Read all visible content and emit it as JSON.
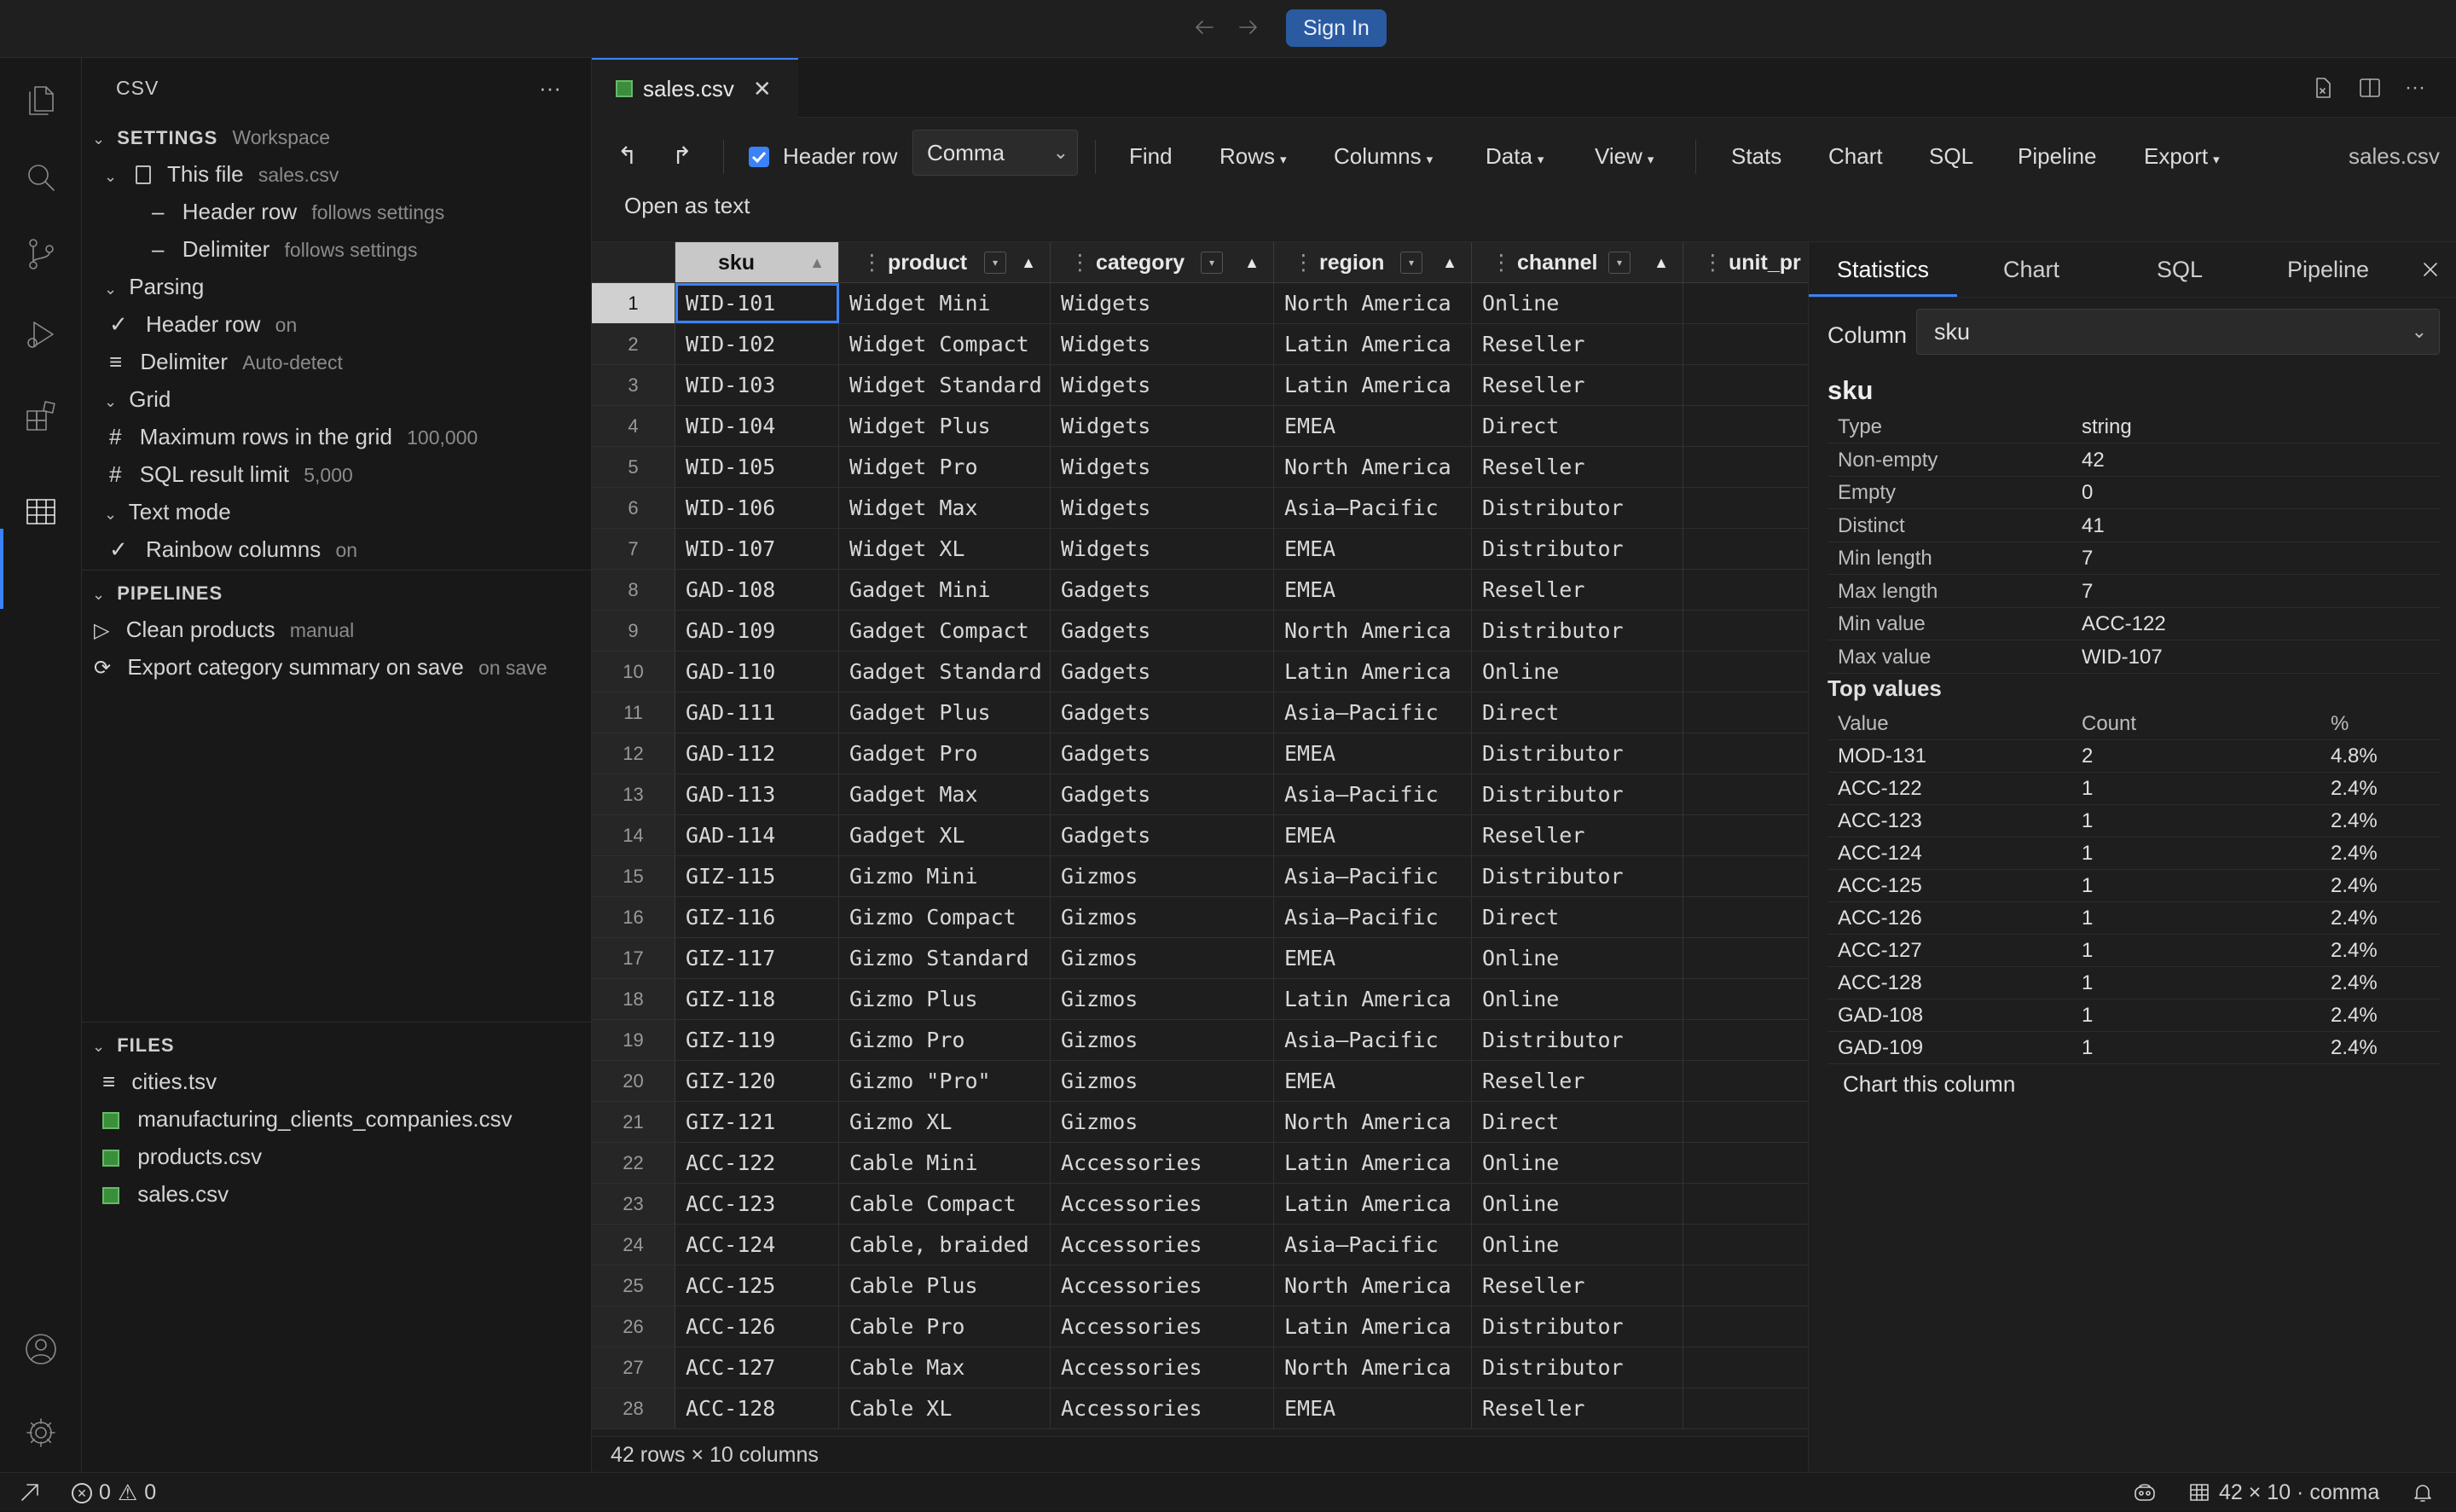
{
  "titlebar": {
    "sign_in": "Sign In"
  },
  "sidebar": {
    "title": "CSV",
    "more": "···",
    "settings_title": "SETTINGS",
    "settings_scope": "Workspace",
    "this_file_label": "This file",
    "this_file_name": "sales.csv",
    "header_row_label": "Header row",
    "header_row_note": "follows settings",
    "delimiter_label": "Delimiter",
    "delimiter_note": "follows settings",
    "parsing_label": "Parsing",
    "parsing_header_label": "Header row",
    "parsing_header_value": "on",
    "parsing_delim_label": "Delimiter",
    "parsing_delim_value": "Auto-detect",
    "grid_label": "Grid",
    "max_rows_label": "Maximum rows in the grid",
    "max_rows_value": "100,000",
    "sql_limit_label": "SQL result limit",
    "sql_limit_value": "5,000",
    "text_mode_label": "Text mode",
    "rainbow_label": "Rainbow columns",
    "rainbow_value": "on",
    "pipelines_title": "PIPELINES",
    "pipeline_1": "Clean products",
    "pipeline_1_mode": "manual",
    "pipeline_2": "Export category summary on save",
    "pipeline_2_mode": "on save",
    "files_title": "FILES",
    "files": [
      "cities.tsv",
      "manufacturing_clients_companies.csv",
      "products.csv",
      "sales.csv"
    ]
  },
  "tab": {
    "name": "sales.csv"
  },
  "toolbar": {
    "header_row": "Header row",
    "delimiter": "Comma",
    "find": "Find",
    "rows": "Rows",
    "columns": "Columns",
    "data": "Data",
    "view": "View",
    "stats": "Stats",
    "chart": "Chart",
    "sql": "SQL",
    "pipeline": "Pipeline",
    "export": "Export",
    "file": "sales.csv",
    "open_as_text": "Open as text"
  },
  "grid": {
    "columns": [
      "sku",
      "product",
      "category",
      "region",
      "channel",
      "unit_pr"
    ],
    "rows": [
      [
        "1",
        "WID-101",
        "Widget Mini",
        "Widgets",
        "North America",
        "Online"
      ],
      [
        "2",
        "WID-102",
        "Widget Compact",
        "Widgets",
        "Latin America",
        "Reseller"
      ],
      [
        "3",
        "WID-103",
        "Widget Standard",
        "Widgets",
        "Latin America",
        "Reseller"
      ],
      [
        "4",
        "WID-104",
        "Widget Plus",
        "Widgets",
        "EMEA",
        "Direct"
      ],
      [
        "5",
        "WID-105",
        "Widget Pro",
        "Widgets",
        "North America",
        "Reseller"
      ],
      [
        "6",
        "WID-106",
        "Widget Max",
        "Widgets",
        "Asia–Pacific",
        "Distributor"
      ],
      [
        "7",
        "WID-107",
        "Widget XL",
        "Widgets",
        "EMEA",
        "Distributor"
      ],
      [
        "8",
        "GAD-108",
        "Gadget Mini",
        "Gadgets",
        "EMEA",
        "Reseller"
      ],
      [
        "9",
        "GAD-109",
        "Gadget Compact",
        "Gadgets",
        "North America",
        "Distributor"
      ],
      [
        "10",
        "GAD-110",
        "Gadget Standard",
        "Gadgets",
        "Latin America",
        "Online"
      ],
      [
        "11",
        "GAD-111",
        "Gadget Plus",
        "Gadgets",
        "Asia–Pacific",
        "Direct"
      ],
      [
        "12",
        "GAD-112",
        "Gadget Pro",
        "Gadgets",
        "EMEA",
        "Distributor"
      ],
      [
        "13",
        "GAD-113",
        "Gadget Max",
        "Gadgets",
        "Asia–Pacific",
        "Distributor"
      ],
      [
        "14",
        "GAD-114",
        "Gadget XL",
        "Gadgets",
        "EMEA",
        "Reseller"
      ],
      [
        "15",
        "GIZ-115",
        "Gizmo Mini",
        "Gizmos",
        "Asia–Pacific",
        "Distributor"
      ],
      [
        "16",
        "GIZ-116",
        "Gizmo Compact",
        "Gizmos",
        "Asia–Pacific",
        "Direct"
      ],
      [
        "17",
        "GIZ-117",
        "Gizmo Standard",
        "Gizmos",
        "EMEA",
        "Online"
      ],
      [
        "18",
        "GIZ-118",
        "Gizmo Plus",
        "Gizmos",
        "Latin America",
        "Online"
      ],
      [
        "19",
        "GIZ-119",
        "Gizmo Pro",
        "Gizmos",
        "Asia–Pacific",
        "Distributor"
      ],
      [
        "20",
        "GIZ-120",
        "Gizmo \"Pro\"",
        "Gizmos",
        "EMEA",
        "Reseller"
      ],
      [
        "21",
        "GIZ-121",
        "Gizmo XL",
        "Gizmos",
        "North America",
        "Direct"
      ],
      [
        "22",
        "ACC-122",
        "Cable Mini",
        "Accessories",
        "Latin America",
        "Online"
      ],
      [
        "23",
        "ACC-123",
        "Cable Compact",
        "Accessories",
        "Latin America",
        "Online"
      ],
      [
        "24",
        "ACC-124",
        "Cable, braided",
        "Accessories",
        "Asia–Pacific",
        "Online"
      ],
      [
        "25",
        "ACC-125",
        "Cable Plus",
        "Accessories",
        "North America",
        "Reseller"
      ],
      [
        "26",
        "ACC-126",
        "Cable Pro",
        "Accessories",
        "Latin America",
        "Distributor"
      ],
      [
        "27",
        "ACC-127",
        "Cable Max",
        "Accessories",
        "North America",
        "Distributor"
      ],
      [
        "28",
        "ACC-128",
        "Cable XL",
        "Accessories",
        "EMEA",
        "Reseller"
      ]
    ],
    "summary": "42 rows × 10 columns"
  },
  "panel": {
    "tabs": [
      "Statistics",
      "Chart",
      "SQL",
      "Pipeline"
    ],
    "column_label": "Column",
    "column_value": "sku",
    "column_name": "sku",
    "stats": [
      [
        "Type",
        "string"
      ],
      [
        "Non-empty",
        "42"
      ],
      [
        "Empty",
        "0"
      ],
      [
        "Distinct",
        "41"
      ],
      [
        "Min length",
        "7"
      ],
      [
        "Max length",
        "7"
      ],
      [
        "Min value",
        "ACC-122"
      ],
      [
        "Max value",
        "WID-107"
      ]
    ],
    "top_values_title": "Top values",
    "top_headers": [
      "Value",
      "Count",
      "%"
    ],
    "top_values": [
      [
        "MOD-131",
        "2",
        "4.8%"
      ],
      [
        "ACC-122",
        "1",
        "2.4%"
      ],
      [
        "ACC-123",
        "1",
        "2.4%"
      ],
      [
        "ACC-124",
        "1",
        "2.4%"
      ],
      [
        "ACC-125",
        "1",
        "2.4%"
      ],
      [
        "ACC-126",
        "1",
        "2.4%"
      ],
      [
        "ACC-127",
        "1",
        "2.4%"
      ],
      [
        "ACC-128",
        "1",
        "2.4%"
      ],
      [
        "GAD-108",
        "1",
        "2.4%"
      ],
      [
        "GAD-109",
        "1",
        "2.4%"
      ]
    ],
    "chart_this": "Chart this column"
  },
  "statusbar": {
    "errors": "0",
    "warnings": "0",
    "grid_info": "42 × 10 · comma"
  },
  "colors": {
    "accent": "#3b82f6",
    "sign_in_bg": "#2a5aa0",
    "file_icon": "#3a8f3a"
  }
}
